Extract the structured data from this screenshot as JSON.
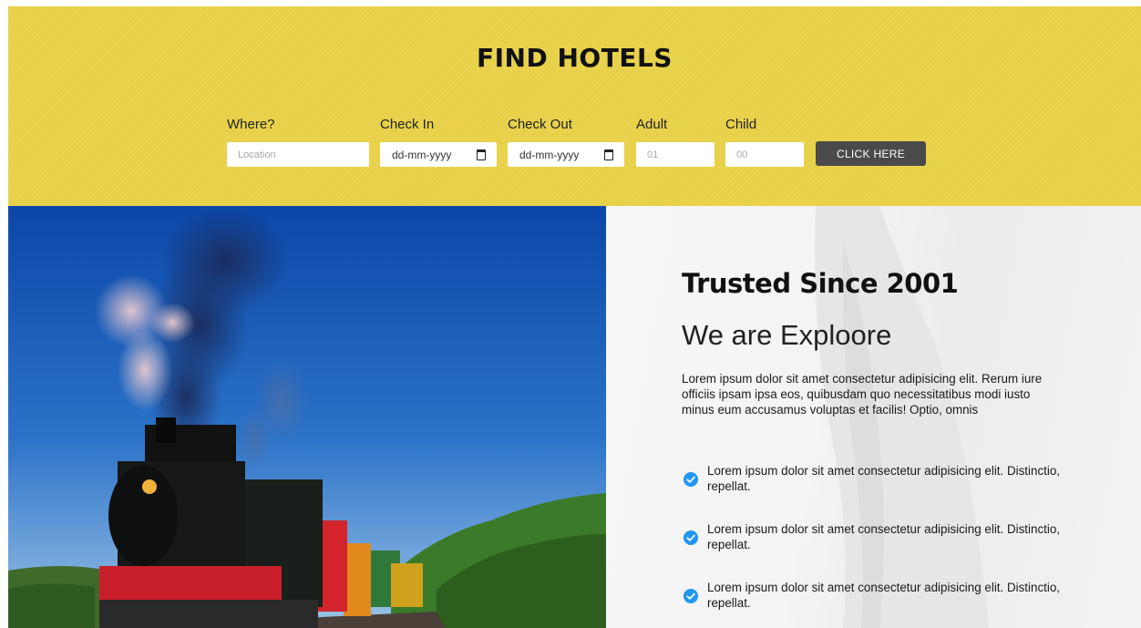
{
  "search": {
    "title": "FIND HOTELS",
    "fields": {
      "where": {
        "label": "Where?",
        "placeholder": "Location"
      },
      "check_in": {
        "label": "Check In",
        "value": "dd-mm-yyyy"
      },
      "check_out": {
        "label": "Check Out",
        "value": "dd-mm-yyyy"
      },
      "adult": {
        "label": "Adult",
        "placeholder": "01"
      },
      "child": {
        "label": "Child",
        "placeholder": "00"
      }
    },
    "button_label": "CLICK HERE"
  },
  "about": {
    "heading": "Trusted Since 2001",
    "subheading": "We are Exploore",
    "paragraph": "Lorem ipsum dolor sit amet consectetur adipisicing elit. Rerum iure officiis ipsam ipsa eos, quibusdam quo necessitatibus modi iusto minus eum accusamus voluptas et facilis! Optio, omnis",
    "features": [
      {
        "text": "Lorem ipsum dolor sit amet consectetur adipisicing elit. Distinctio, repellat."
      },
      {
        "text": "Lorem ipsum dolor sit amet consectetur adipisicing elit. Distinctio, repellat."
      },
      {
        "text": "Lorem ipsum dolor sit amet consectetur adipisicing elit. Distinctio, repellat."
      }
    ]
  },
  "icons": {
    "calendar": "calendar-icon",
    "check": "check-circle-icon"
  },
  "colors": {
    "band_yellow": "#e8d148",
    "button_dark": "#4a4a4a",
    "check_blue": "#2196f3"
  }
}
